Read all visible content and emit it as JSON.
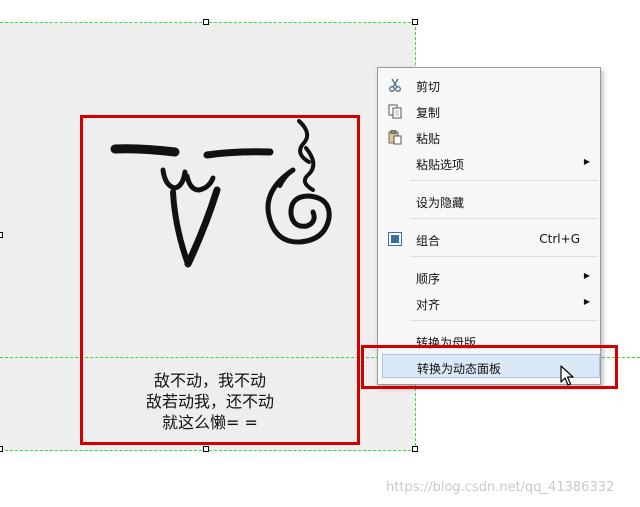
{
  "canvas": {
    "caption_lines": [
      "敌不动，我不动",
      "敌若动我，还不动",
      "就这么懒= ="
    ]
  },
  "context_menu": {
    "items": [
      {
        "label": "剪切",
        "icon": "scissors-icon"
      },
      {
        "label": "复制",
        "icon": "copy-icon"
      },
      {
        "label": "粘贴",
        "icon": "paste-icon"
      },
      {
        "label": "粘贴选项",
        "submenu": true
      },
      {
        "label": "设为隐藏"
      },
      {
        "label": "组合",
        "icon": "group-icon",
        "shortcut": "Ctrl+G"
      },
      {
        "label": "顺序",
        "submenu": true
      },
      {
        "label": "对齐",
        "submenu": true
      },
      {
        "label": "转换为母版"
      },
      {
        "label": "转换为动态面板",
        "highlighted": true
      }
    ]
  },
  "watermark": "https://blog.csdn.net/qq_41386332",
  "colors": {
    "highlight_red": "#d40000",
    "guide_green": "#33dd33",
    "menu_hover": "#dbe8f7"
  }
}
